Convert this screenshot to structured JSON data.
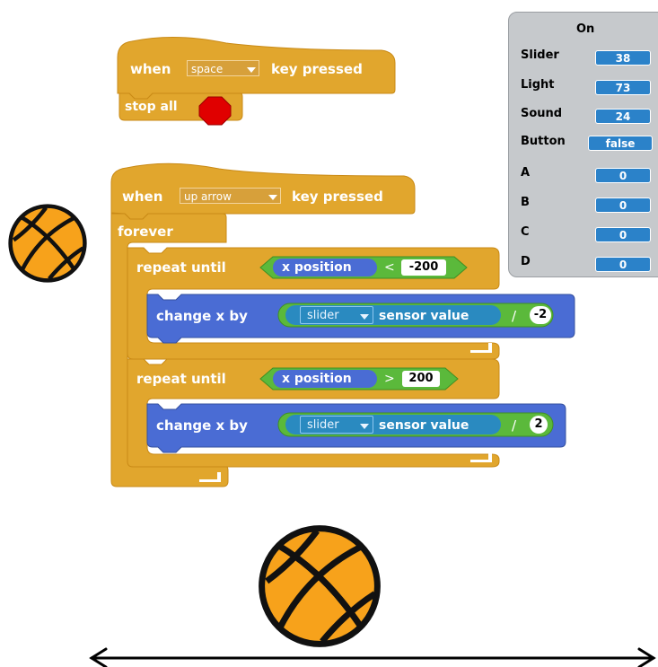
{
  "script1": {
    "hat_when": "when",
    "key_dropdown": "space",
    "hat_key_pressed": "key pressed",
    "stop_all": "stop all",
    "stop_icon": "stop-sign-icon"
  },
  "script2": {
    "hat_when": "when",
    "key_dropdown": "up arrow",
    "hat_key_pressed": "key pressed",
    "forever": "forever",
    "loop1": {
      "repeat_until": "repeat until",
      "reporter": "x position",
      "operator": "<",
      "operand": "-200",
      "change_x_by": "change x by",
      "sensor_dropdown": "slider",
      "sensor_value": "sensor value",
      "divide": "/",
      "divisor": "-2"
    },
    "loop2": {
      "repeat_until": "repeat until",
      "reporter": "x position",
      "operator": ">",
      "operand": "200",
      "change_x_by": "change x by",
      "sensor_dropdown": "slider",
      "sensor_value": "sensor value",
      "divide": "/",
      "divisor": "2"
    }
  },
  "sensor_board": {
    "title": "On",
    "rows": [
      {
        "label": "Slider",
        "value": "38"
      },
      {
        "label": "Light",
        "value": "73"
      },
      {
        "label": "Sound",
        "value": "24"
      },
      {
        "label": "Button",
        "value": "false"
      },
      {
        "label": "A",
        "value": "0"
      },
      {
        "label": "B",
        "value": "0"
      },
      {
        "label": "C",
        "value": "0"
      },
      {
        "label": "D",
        "value": "0"
      }
    ]
  },
  "colors": {
    "control_block": "#e1a62d",
    "motion_block": "#4a6cd4",
    "operator_block": "#5bb93b",
    "sensor_block": "#2a8ac0",
    "panel_bg": "#c6c9cc",
    "sensor_value_bg": "#2b82c9",
    "basketball": "#f7a21b"
  },
  "icons": {
    "basketball_small": "basketball-icon",
    "basketball_large": "basketball-icon",
    "arrow": "double-headed-arrow-icon"
  }
}
